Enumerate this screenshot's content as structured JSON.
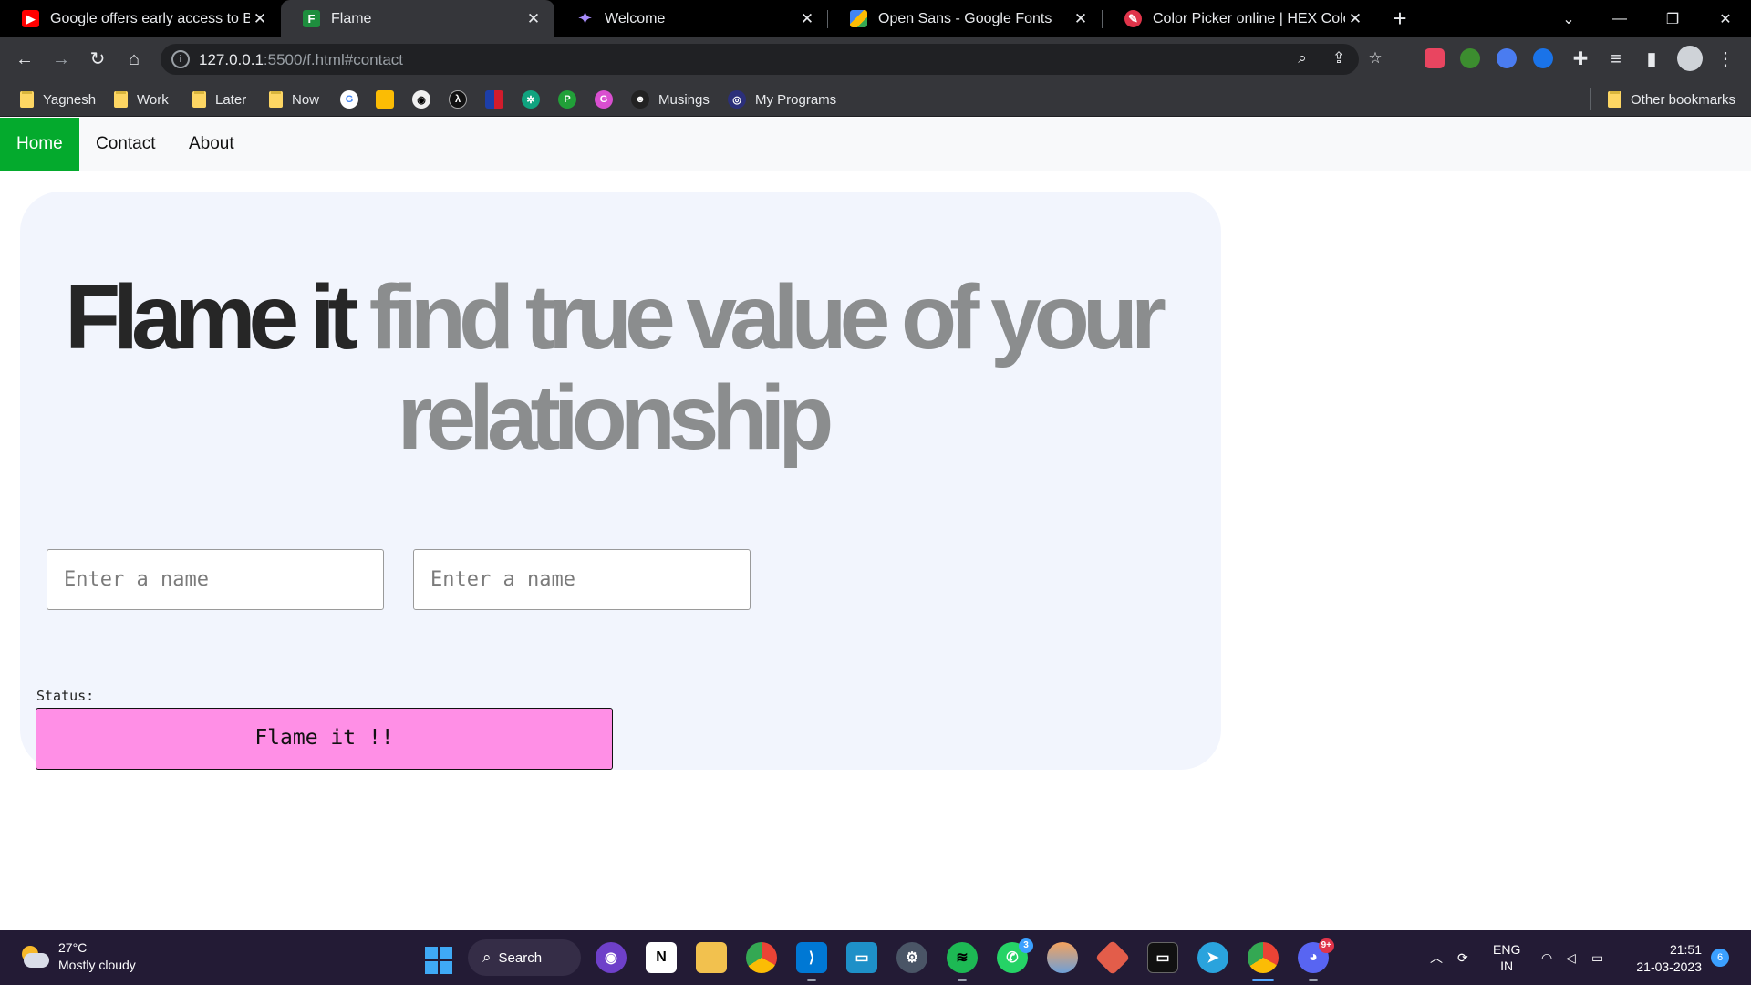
{
  "browser": {
    "tabs": [
      {
        "title": "Google offers early access to Bar",
        "icon": "youtube-icon"
      },
      {
        "title": "Flame",
        "icon": "flame-favicon"
      },
      {
        "title": "Welcome",
        "icon": "sparkle-icon"
      },
      {
        "title": "Open Sans - Google Fonts",
        "icon": "google-fonts-icon"
      },
      {
        "title": "Color Picker online | HEX Colo",
        "icon": "color-picker-icon"
      }
    ],
    "active_tab": 1,
    "url_host": "127.0.0.1",
    "url_rest": ":5500/f.html#contact",
    "bookmarks": [
      {
        "label": "Yagnesh",
        "type": "folder"
      },
      {
        "label": "Work",
        "type": "folder"
      },
      {
        "label": "Later",
        "type": "folder"
      },
      {
        "label": "Now",
        "type": "folder"
      },
      {
        "label": "Musings",
        "type": "link"
      },
      {
        "label": "My Programs",
        "type": "link"
      }
    ],
    "other_bookmarks": "Other bookmarks"
  },
  "page": {
    "nav": [
      {
        "label": "Home",
        "active": true
      },
      {
        "label": "Contact",
        "active": false
      },
      {
        "label": "About",
        "active": false
      }
    ],
    "hero": {
      "brand": "Flame it",
      "tagline": "find true value of your relationship"
    },
    "inputs": [
      {
        "placeholder": "Enter a name",
        "value": ""
      },
      {
        "placeholder": "Enter a name",
        "value": ""
      }
    ],
    "status_label": "Status:",
    "button_label": "Flame it !!",
    "colors": {
      "nav_active": "#04aa2d",
      "card_bg": "#f2f5fd",
      "button_bg": "#ff8fe6",
      "hero_dark": "#262626",
      "hero_grey": "#8b8d8e"
    }
  },
  "taskbar": {
    "weather_temp": "27°C",
    "weather_desc": "Mostly cloudy",
    "search_label": "Search",
    "whatsapp_badge": "3",
    "discord_badge": "9+",
    "lang_line1": "ENG",
    "lang_line2": "IN",
    "time": "21:51",
    "date": "21-03-2023",
    "notification_count": "6"
  }
}
